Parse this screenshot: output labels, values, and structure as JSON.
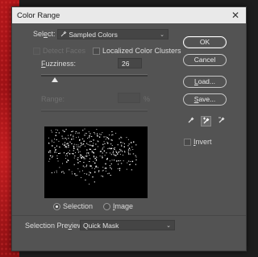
{
  "dialog": {
    "title": "Color Range",
    "close_icon": "close-icon"
  },
  "select": {
    "label_pre": "Sel",
    "label_ul": "e",
    "label_post": "ct:",
    "icon": "eyedropper-icon",
    "value": "Sampled Colors"
  },
  "detect_faces": {
    "label": "Detect Faces",
    "checked": false,
    "enabled": false
  },
  "localized_clusters": {
    "label_ul": "Z",
    "label_post": " Localized Color Clusters",
    "checked": false
  },
  "fuzziness": {
    "label_ul": "F",
    "label_post": "uzziness:",
    "value": "26",
    "level": 0.13
  },
  "range": {
    "label": "Range:",
    "value": "",
    "unit": "%",
    "enabled": false
  },
  "view": {
    "selection_label": "Selection",
    "image_label_ul": "I",
    "image_label_post": "mage",
    "selected": "Selection"
  },
  "selection_preview": {
    "label_pre": "Selection Pre",
    "label_ul": "v",
    "label_post": "iew:",
    "value": "Quick Mask"
  },
  "buttons": {
    "ok": "OK",
    "cancel": "Cancel",
    "load_ul": "L",
    "load_post": "oad...",
    "save_ul": "S",
    "save_post": "ave..."
  },
  "eyedroppers": [
    "eyedropper-icon",
    "eyedropper-plus-icon",
    "eyedropper-minus-icon"
  ],
  "invert": {
    "label_ul": "I",
    "label_post": "nvert",
    "checked": false
  },
  "colors": {
    "dialog_bg": "#535353",
    "titlebar_bg": "#e9e9e9",
    "preview_bg": "#000000",
    "background_red": "#b3161a"
  }
}
